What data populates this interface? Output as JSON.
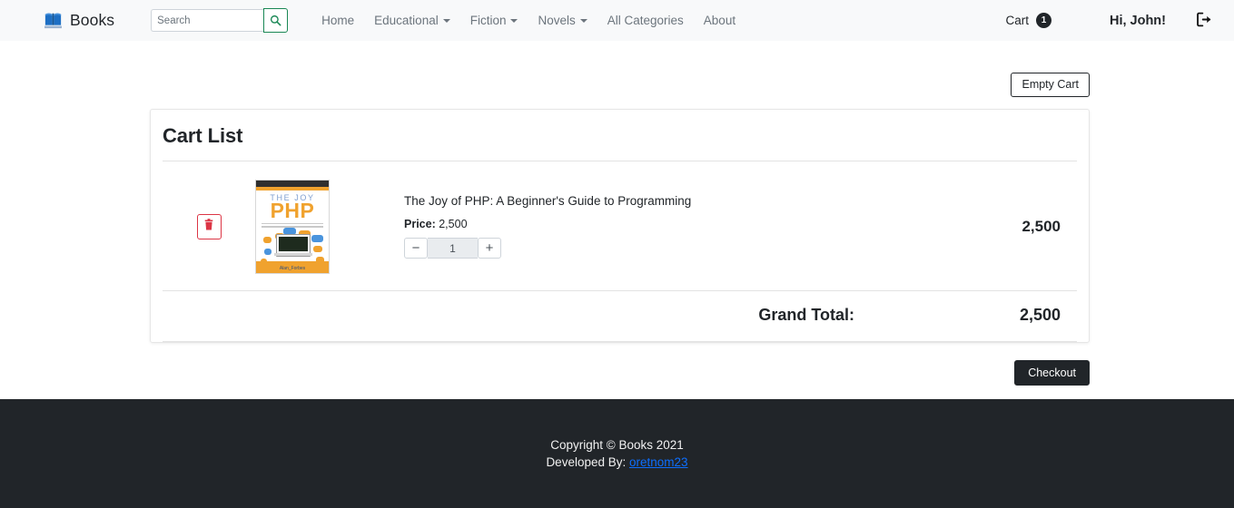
{
  "navbar": {
    "brand": "Books",
    "brand_icon": "book-icon",
    "search": {
      "placeholder": "Search",
      "value": "",
      "button_icon": "search-icon"
    },
    "links": [
      {
        "label": "Home",
        "dropdown": false
      },
      {
        "label": "Educational",
        "dropdown": true
      },
      {
        "label": "Fiction",
        "dropdown": true
      },
      {
        "label": "Novels",
        "dropdown": true
      },
      {
        "label": "All Categories",
        "dropdown": false
      },
      {
        "label": "About",
        "dropdown": false
      }
    ],
    "cart": {
      "label": "Cart",
      "count": "1"
    },
    "greeting": "Hi, John!",
    "logout_icon": "logout-icon"
  },
  "toolbar": {
    "empty_cart_label": "Empty Cart"
  },
  "card": {
    "title": "Cart List",
    "items": [
      {
        "delete_icon": "trash-icon",
        "cover": {
          "line_top": "THE  JOY",
          "title": "PHP",
          "author": "Alan_Forbes"
        },
        "name": "The Joy of PHP: A Beginner's Guide to Programming",
        "price_label": "Price:",
        "price": "2,500",
        "qty": "1",
        "decrement": "−",
        "increment": "+",
        "total": "2,500"
      }
    ],
    "grand_total_label": "Grand Total:",
    "grand_total_value": "2,500"
  },
  "checkout": {
    "label": "Checkout"
  },
  "footer": {
    "copyright": "Copyright © Books 2021",
    "developed_prefix": "Developed By:",
    "developer": "oretnom23"
  },
  "colors": {
    "navbar_bg": "#f8f9fa",
    "footer_bg": "#212529",
    "accent_green": "#198754",
    "danger_red": "#dc3545",
    "link_blue": "#0d6efd",
    "muted_text": "#6c757d"
  }
}
